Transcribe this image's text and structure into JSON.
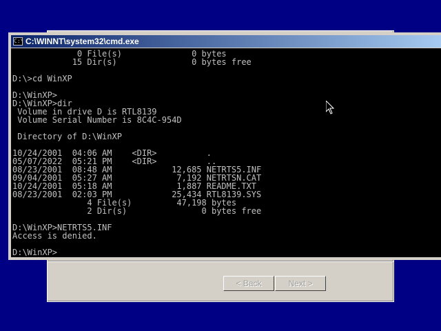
{
  "wizard": {
    "back_label": "< Back",
    "next_label": "Next >"
  },
  "cmd": {
    "title": "C:\\WINNT\\system32\\cmd.exe",
    "icon": "cmd-icon",
    "lines": [
      "             0 File(s)              0 bytes",
      "            15 Dir(s)               0 bytes free",
      "",
      "D:\\>cd WinXP",
      "",
      "D:\\WinXP>",
      "D:\\WinXP>dir",
      " Volume in drive D is RTL8139",
      " Volume Serial Number is 8C4C-954D",
      "",
      " Directory of D:\\WinXP",
      "",
      "10/24/2001  04:06 AM    <DIR>          .",
      "05/07/2022  05:21 PM    <DIR>          ..",
      "08/23/2001  08:48 AM            12,685 NETRTS5.INF",
      "09/04/2001  05:27 AM             7,192 NETRTSN.CAT",
      "10/24/2001  05:18 AM             1,887 README.TXT",
      "08/23/2001  02:03 PM            25,434 RTL8139.SYS",
      "               4 File(s)         47,198 bytes",
      "               2 Dir(s)               0 bytes free",
      "",
      "D:\\WinXP>NETRTS5.INF",
      "Access is denied.",
      "",
      "D:\\WinXP>"
    ]
  }
}
